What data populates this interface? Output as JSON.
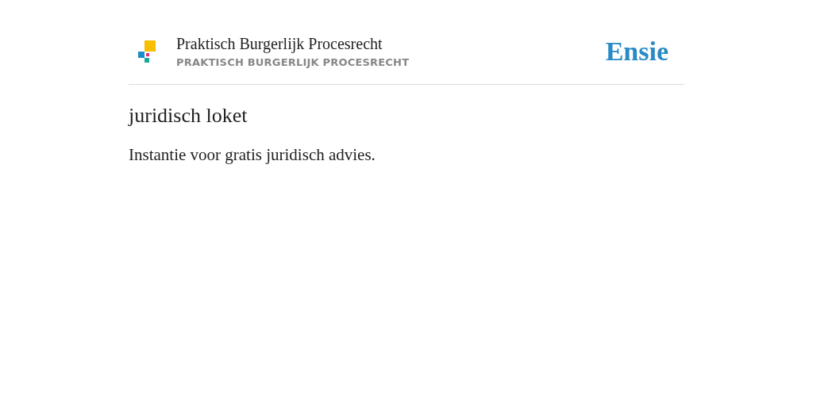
{
  "header": {
    "title": "Praktisch Burgerlijk Procesrecht",
    "subtitle": "PRAKTISCH BURGERLIJK PROCESRECHT",
    "brand": "Ensie"
  },
  "entry": {
    "term": "juridisch loket",
    "definition": "Instantie voor gratis juridisch advies."
  }
}
